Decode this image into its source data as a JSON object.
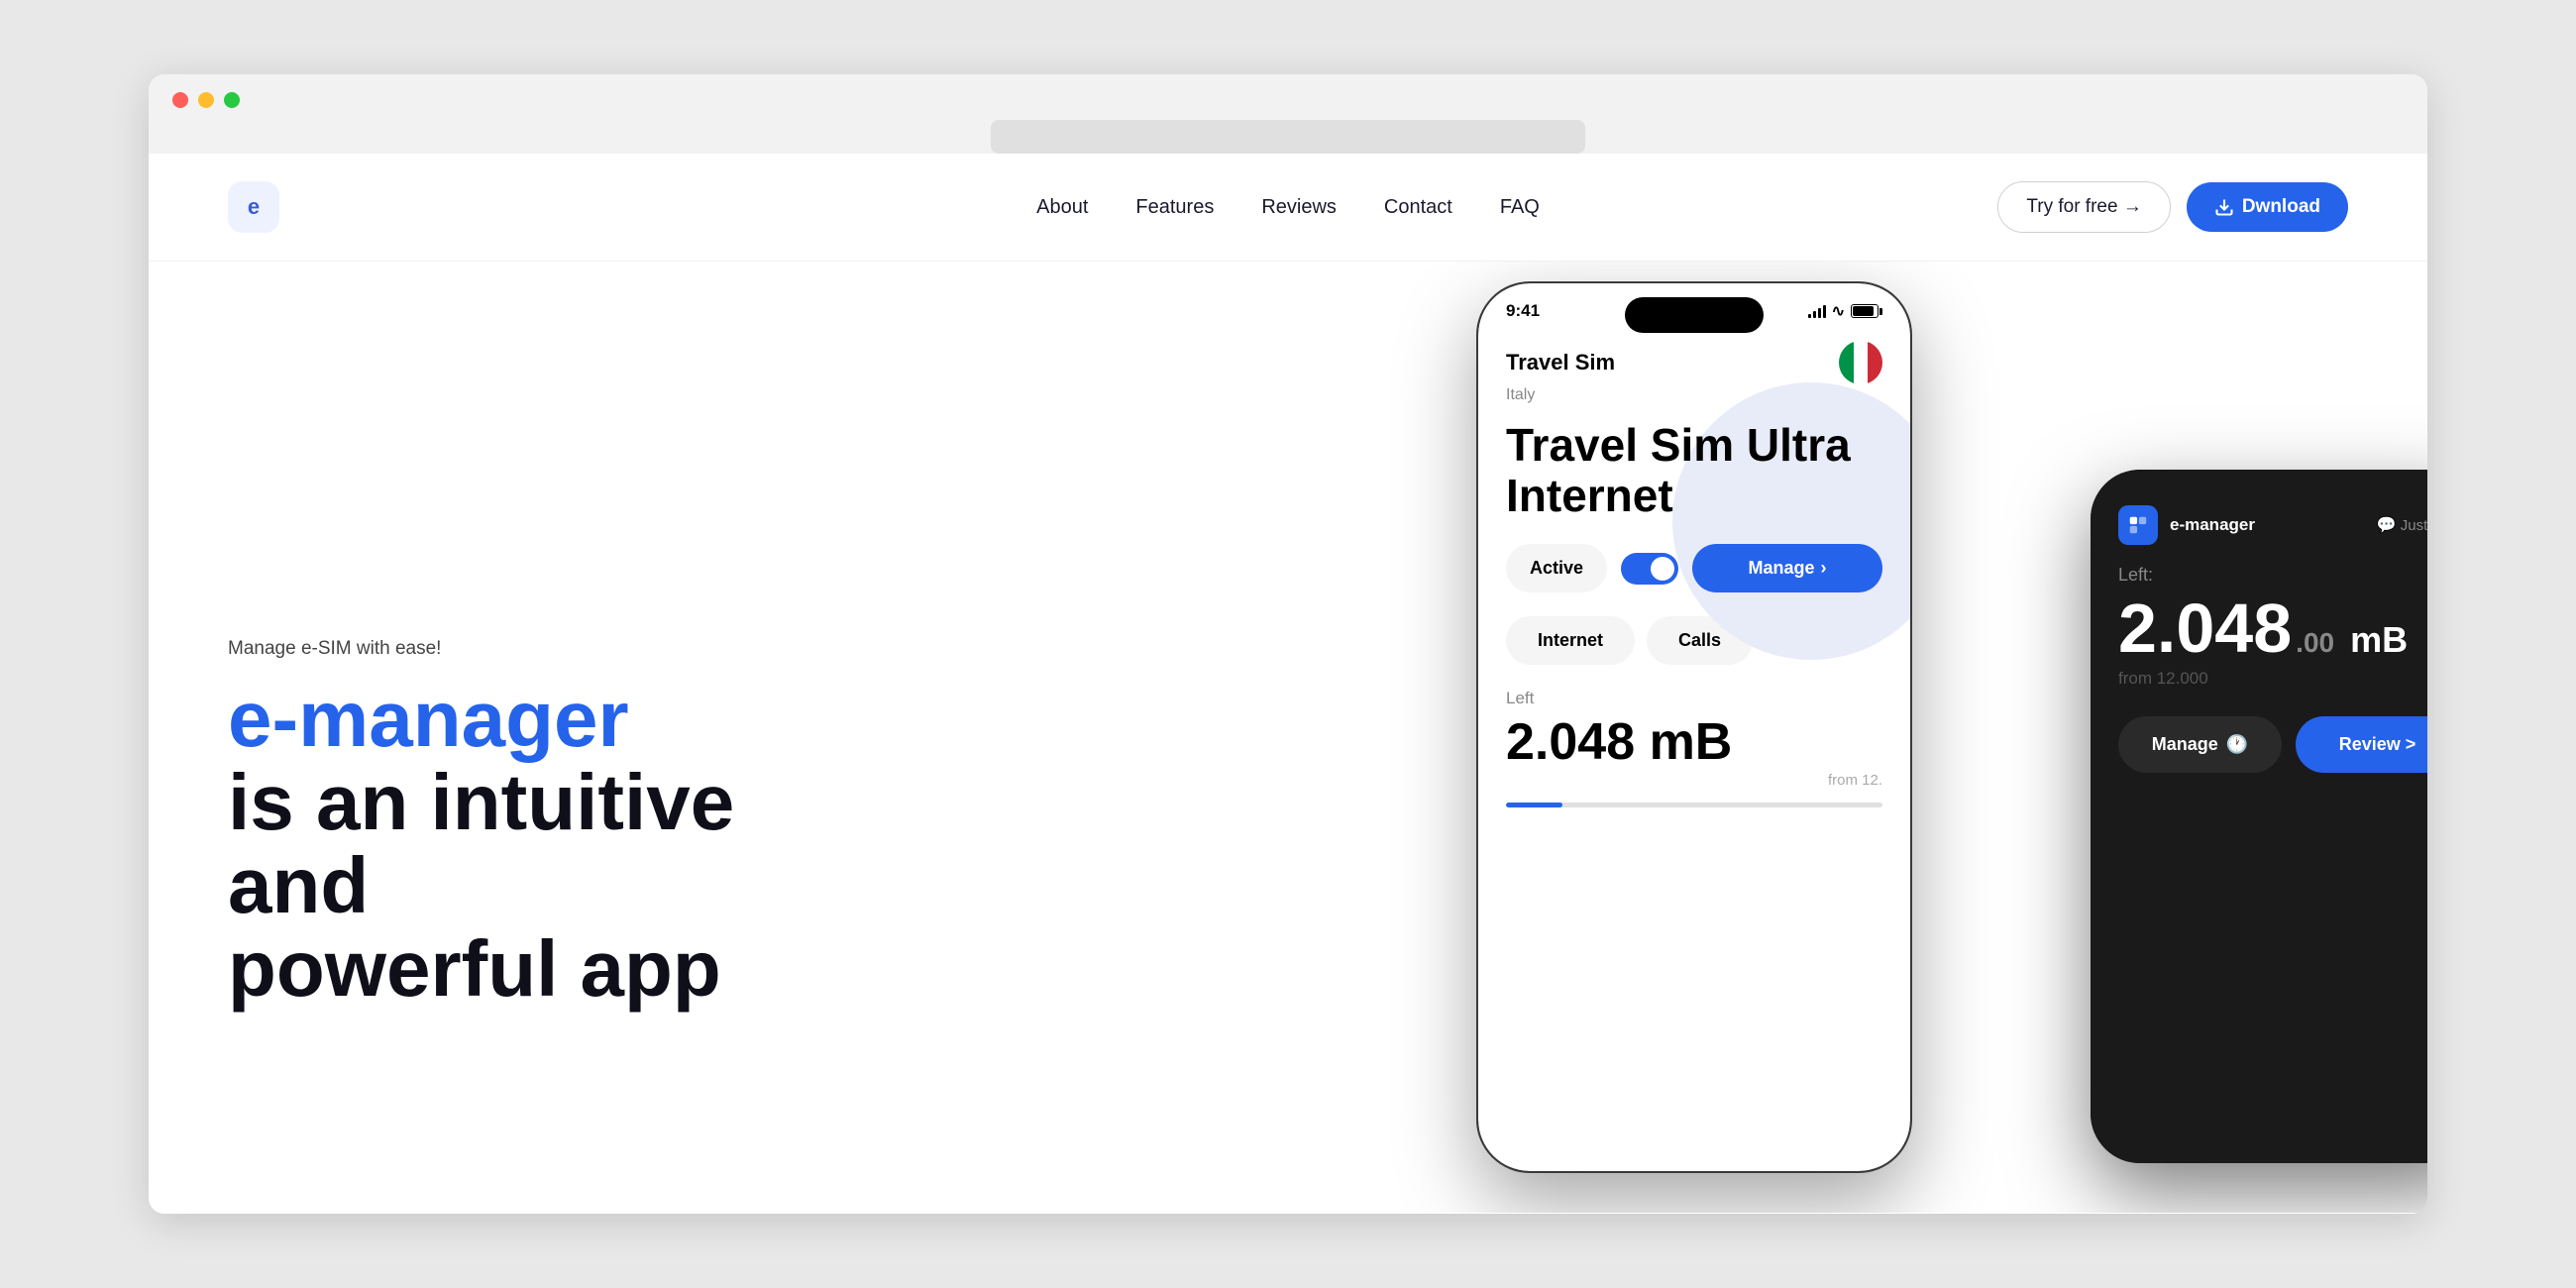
{
  "browser": {
    "traffic_lights": [
      "red",
      "yellow",
      "green"
    ]
  },
  "nav": {
    "logo": "e",
    "links": [
      {
        "label": "About",
        "id": "about"
      },
      {
        "label": "Features",
        "id": "features"
      },
      {
        "label": "Reviews",
        "id": "reviews"
      },
      {
        "label": "Contact",
        "id": "contact"
      },
      {
        "label": "FAQ",
        "id": "faq"
      }
    ],
    "try_free_label": "Try for free →",
    "download_label": "Dwnload"
  },
  "hero": {
    "subtitle": "Manage e-SIM with ease!",
    "brand": "e-manager",
    "title_suffix": "\nis an intuitive and\npowerful app"
  },
  "phone_main": {
    "time": "9:41",
    "sim_name": "Travel Sim",
    "sim_country": "Italy",
    "plan_title": "Travel Sim Ultra\nInternet",
    "active_label": "Active",
    "manage_label": "Manage",
    "tabs": [
      "Internet",
      "Calls"
    ],
    "data_label": "Left",
    "data_amount": "2.048 mB",
    "data_from": "from 12."
  },
  "phone_dark": {
    "app_name": "e-manager",
    "time_label": "Just now",
    "left_label": "Left:",
    "data_big": "2.048",
    "data_decimal": ".00",
    "data_unit": "mB",
    "from_label": "from 12.000",
    "manage_label": "Manage",
    "review_label": "Review >"
  }
}
